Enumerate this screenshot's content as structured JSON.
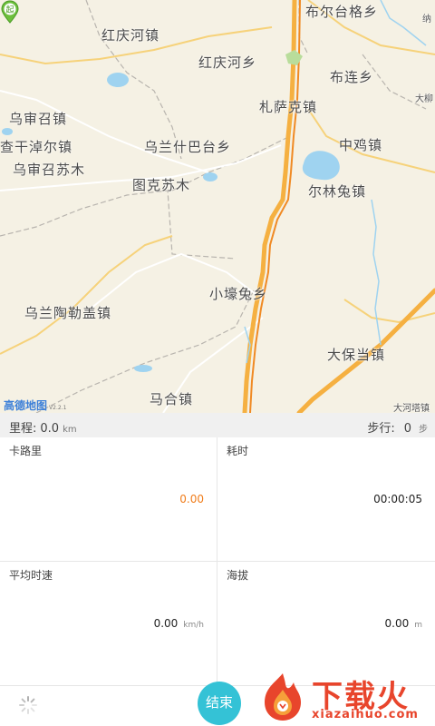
{
  "map": {
    "places": [
      {
        "key": "hongqinghe_zhen",
        "label": "红庆河镇"
      },
      {
        "key": "buertaige",
        "label": "布尔台格乡"
      },
      {
        "key": "na",
        "label": "纳"
      },
      {
        "key": "hongqinghe_xiang",
        "label": "红庆河乡"
      },
      {
        "key": "bulian",
        "label": "布连乡"
      },
      {
        "key": "dalu",
        "label": "大柳"
      },
      {
        "key": "wushenzhao",
        "label": "乌审召镇"
      },
      {
        "key": "zhasake",
        "label": "札萨克镇"
      },
      {
        "key": "chaganzhuer",
        "label": "查干淖尔镇"
      },
      {
        "key": "wulanshibatai",
        "label": "乌兰什巴台乡"
      },
      {
        "key": "zhongji",
        "label": "中鸡镇"
      },
      {
        "key": "wushenzhaosumu",
        "label": "乌审召苏木"
      },
      {
        "key": "tukesumu",
        "label": "图克苏木"
      },
      {
        "key": "erlintu",
        "label": "尔林兔镇"
      },
      {
        "key": "xiaohaotu",
        "label": "小壕兔乡"
      },
      {
        "key": "wulantaolegai",
        "label": "乌兰陶勒盖镇"
      },
      {
        "key": "dabaodang",
        "label": "大保当镇"
      },
      {
        "key": "mahe",
        "label": "马合镇"
      },
      {
        "key": "daheta",
        "label": "大河塔镇"
      }
    ],
    "logo": "高德地图",
    "logo_version": "V2.2.1",
    "start_marker": "起"
  },
  "infobar": {
    "distance_label": "里程:",
    "distance_value": "0.0",
    "distance_unit": "km",
    "steps_label": "步行:",
    "steps_value": "0",
    "steps_unit": "步"
  },
  "stats": {
    "calories": {
      "label": "卡路里",
      "value": "0.00"
    },
    "duration": {
      "label": "耗时",
      "value": "00:00:05"
    },
    "avg_speed": {
      "label": "平均时速",
      "value": "0.00",
      "unit": "km/h"
    },
    "altitude": {
      "label": "海拔",
      "value": "0.00",
      "unit": "m"
    }
  },
  "bottom": {
    "end_label": "结束"
  },
  "watermark": {
    "text": "下载火",
    "url": "xiazaihuo.com"
  },
  "colors": {
    "accent": "#34c2d6",
    "calorie_value": "#f07c1a",
    "watermark": "#e8452c",
    "road_main": "#f5b041",
    "map_bg": "#f5f1e4",
    "water": "#9fd3f0"
  }
}
